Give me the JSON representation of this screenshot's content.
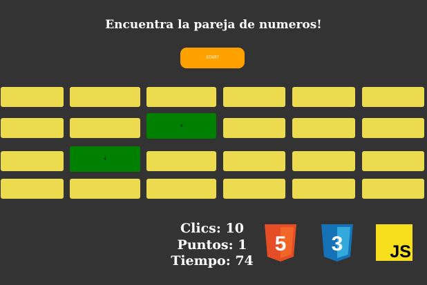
{
  "title": "Encuentra la pareja de numeros!",
  "start_label": "START",
  "cards": {
    "r1": [
      "",
      "",
      "",
      "",
      "",
      ""
    ],
    "r2": [
      "",
      "",
      "4",
      "",
      "",
      ""
    ],
    "r3": [
      "",
      "4",
      "",
      "",
      "",
      ""
    ],
    "r4": [
      "",
      "",
      "",
      "",
      "",
      ""
    ]
  },
  "stats": {
    "clics": "Clics: 10",
    "puntos": "Puntos: 1",
    "tiempo": "Tiempo: 74"
  },
  "logos": {
    "html5": "5",
    "css3": "3",
    "js": "JS"
  },
  "colors": {
    "background": "#333333",
    "card": "#ecdb4e",
    "matched": "#008000",
    "start": "#ffa200"
  }
}
